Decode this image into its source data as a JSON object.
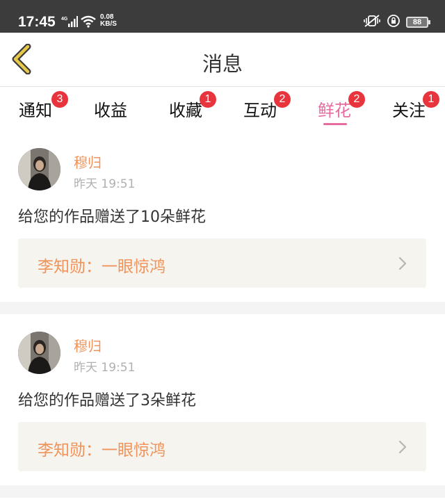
{
  "status_bar": {
    "time": "17:45",
    "network": "4G",
    "speed_value": "0.08",
    "speed_unit": "KB/S",
    "battery": "88"
  },
  "header": {
    "title": "消息"
  },
  "tabs": [
    {
      "label": "通知",
      "badge": "3"
    },
    {
      "label": "收益",
      "badge": ""
    },
    {
      "label": "收藏",
      "badge": "1"
    },
    {
      "label": "互动",
      "badge": "2"
    },
    {
      "label": "鲜花",
      "badge": "2",
      "active": true
    },
    {
      "label": "关注",
      "badge": "1"
    }
  ],
  "messages": [
    {
      "user": "穆归",
      "time": "昨天 19:51",
      "text": "给您的作品赠送了10朵鲜花",
      "work": "李知勋：一眼惊鸿"
    },
    {
      "user": "穆归",
      "time": "昨天 19:51",
      "text": "给您的作品赠送了3朵鲜花",
      "work": "李知勋：一眼惊鸿"
    }
  ],
  "colors": {
    "accent_pink": "#e86a9e",
    "accent_orange": "#f0935a",
    "badge_red": "#e8343c",
    "back_arrow": "#e6c84a"
  }
}
